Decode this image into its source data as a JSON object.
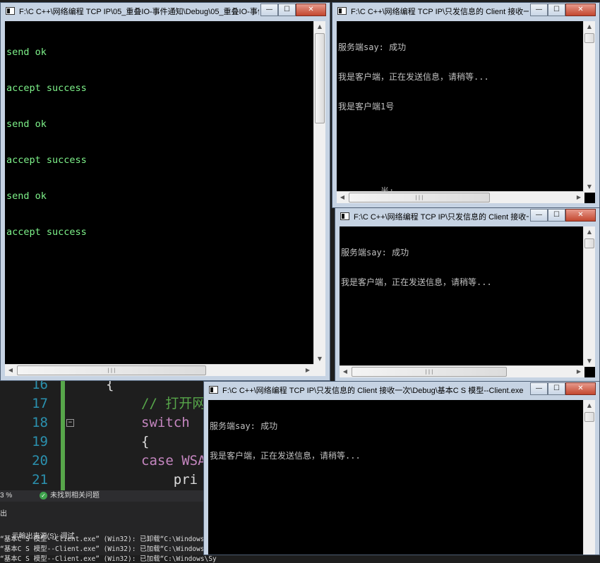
{
  "ide": {
    "code_lines": [
      {
        "num": "16",
        "text": "{",
        "color": "#dcdcdc"
      },
      {
        "num": "17",
        "text": "// 打开网",
        "color": "#57a64a"
      },
      {
        "num": "18",
        "text": "switch",
        "color": "#c586c0"
      },
      {
        "num": "19",
        "text": "{",
        "color": "#dcdcdc"
      },
      {
        "num": "20",
        "text": "case WSA",
        "color": "#c586c0"
      },
      {
        "num": "21",
        "text": "    pri",
        "color": "#dcdcdc"
      }
    ],
    "zoom": "3 %",
    "status_message": "未找到相关问题",
    "output_title": "出",
    "output_source_label": "示輸出来源(S):",
    "output_source_value": "调试",
    "output_lines": [
      "“基本C S 模型--Client.exe” (Win32): 已卸载“C:\\Windows\\Sy",
      "“基本C S 模型--Client.exe” (Win32): 已加载“C:\\Windows\\Sy",
      "“基本C S 模型--Client.exe” (Win32): 已加载“C:\\Windows\\Sy"
    ]
  },
  "windows": [
    {
      "title": "F:\\C C++\\网络编程 TCP IP\\05_重叠IO-事件通知\\Debug\\05_重叠IO-事件...",
      "text_color": "#7ef28a",
      "lines": [
        "send ok",
        "accept success",
        "send ok",
        "accept success",
        "send ok",
        "accept success"
      ]
    },
    {
      "title": "F:\\C C++\\网络编程 TCP IP\\只发信息的 Client 接收一...",
      "text_color": "#c0c0c0",
      "lines": [
        "服务端say: 成功",
        "我是客户端，正在发送信息，请稍等...",
        "我是客户端1号"
      ],
      "ime_text": "半:"
    },
    {
      "title": "F:\\C C++\\网络编程 TCP IP\\只发信息的 Client 接收一...",
      "text_color": "#c0c0c0",
      "lines": [
        "服务端say: 成功",
        "我是客户端，正在发送信息，请稍等..."
      ]
    },
    {
      "title": "F:\\C C++\\网络编程 TCP IP\\只发信息的 Client 接收一次\\Debug\\基本C S 模型--Client.exe",
      "text_color": "#c0c0c0",
      "lines": [
        "服务端say: 成功",
        "我是客户端，正在发送信息，请稍等..."
      ]
    }
  ],
  "caption_buttons": {
    "minimize": "—",
    "maximize": "☐",
    "close": "✕"
  },
  "scroll_glyphs": {
    "up": "▲",
    "down": "▼",
    "left": "◀",
    "right": "▶",
    "grip": "|||"
  },
  "colors": {
    "console_bg": "#000000",
    "titlebar": "#c6d3e3",
    "close_button": "#c3472f"
  }
}
